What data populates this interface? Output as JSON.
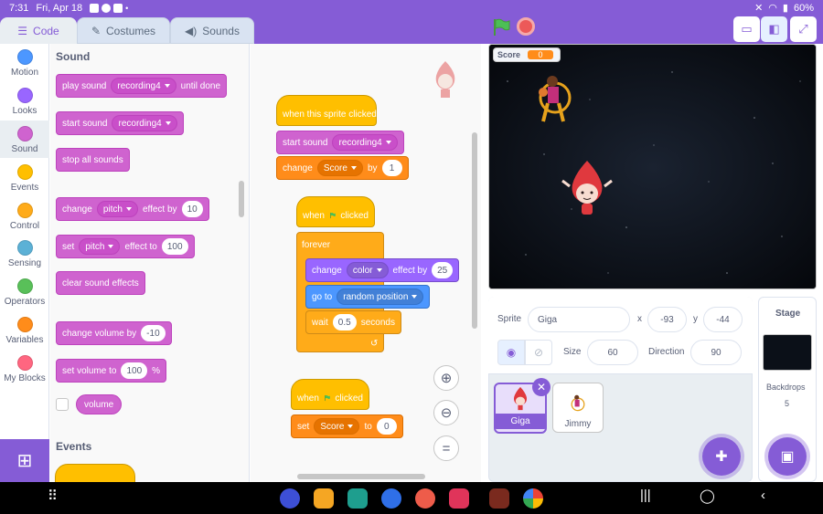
{
  "status_bar": {
    "time": "7:31",
    "date": "Fri, Apr 18",
    "battery": "60%"
  },
  "tabs": {
    "code": "Code",
    "costumes": "Costumes",
    "sounds": "Sounds"
  },
  "categories": [
    "Motion",
    "Looks",
    "Sound",
    "Events",
    "Control",
    "Sensing",
    "Operators",
    "Variables",
    "My Blocks"
  ],
  "category_colors": [
    "#4c97ff",
    "#9966ff",
    "#cf63cf",
    "#ffbf00",
    "#ffab19",
    "#5cb1d6",
    "#59c059",
    "#ff8c1a",
    "#ff6680"
  ],
  "palette": {
    "sound_header": "Sound",
    "events_header": "Events",
    "play_sound": {
      "text": "play sound",
      "sound": "recording4",
      "suffix": "until done"
    },
    "start_sound": {
      "text": "start sound",
      "sound": "recording4"
    },
    "stop_all": "stop all sounds",
    "change_effect": {
      "text": "change",
      "effect": "pitch",
      "mid": "effect by",
      "value": "10"
    },
    "set_effect": {
      "text": "set",
      "effect": "pitch",
      "mid": "effect to",
      "value": "100"
    },
    "clear_effects": "clear sound effects",
    "change_volume": {
      "text": "change volume by",
      "value": "-10"
    },
    "set_volume": {
      "text": "set volume to",
      "value": "100",
      "unit": "%"
    },
    "volume_reporter": "volume"
  },
  "scripts": {
    "s1_hat": "when this sprite clicked",
    "s1_start": {
      "text": "start sound",
      "sound": "recording4"
    },
    "s1_change": {
      "text": "change",
      "var": "Score",
      "mid": "by",
      "value": "1"
    },
    "s2_hat": {
      "pre": "when",
      "post": "clicked"
    },
    "s2_forever": "forever",
    "s2_change": {
      "text": "change",
      "effect": "color",
      "mid": "effect by",
      "value": "25"
    },
    "s2_goto": {
      "text": "go to",
      "target": "random position"
    },
    "s2_wait": {
      "text": "wait",
      "value": "0.5",
      "unit": "seconds"
    },
    "s3_hat": {
      "pre": "when",
      "post": "clicked"
    },
    "s3_set": {
      "text": "set",
      "var": "Score",
      "mid": "to",
      "value": "0"
    }
  },
  "stage": {
    "monitor_label": "Score",
    "monitor_value": "0"
  },
  "sprite_info": {
    "sprite_label": "Sprite",
    "sprite_name": "Giga",
    "x_label": "x",
    "x_value": "-93",
    "y_label": "y",
    "y_value": "-44",
    "size_label": "Size",
    "size_value": "60",
    "direction_label": "Direction",
    "direction_value": "90"
  },
  "sprites": [
    "Giga",
    "Jimmy"
  ],
  "stage_pane": {
    "title": "Stage",
    "backdrops_label": "Backdrops",
    "backdrops_count": "5"
  }
}
